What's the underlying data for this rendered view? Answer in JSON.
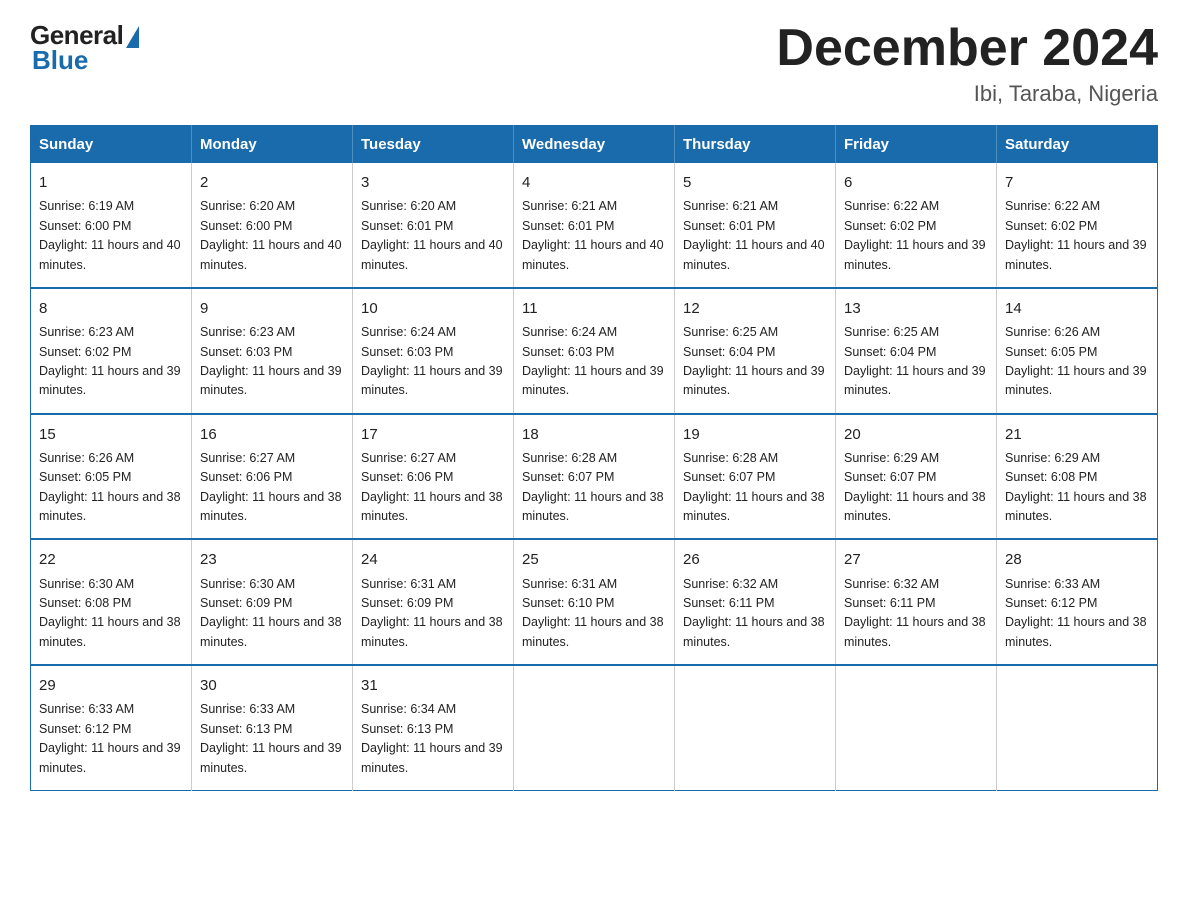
{
  "header": {
    "logo_general": "General",
    "logo_blue": "Blue",
    "title": "December 2024",
    "subtitle": "Ibi, Taraba, Nigeria"
  },
  "weekdays": [
    "Sunday",
    "Monday",
    "Tuesday",
    "Wednesday",
    "Thursday",
    "Friday",
    "Saturday"
  ],
  "weeks": [
    [
      {
        "day": "1",
        "sunrise": "6:19 AM",
        "sunset": "6:00 PM",
        "daylight": "11 hours and 40 minutes."
      },
      {
        "day": "2",
        "sunrise": "6:20 AM",
        "sunset": "6:00 PM",
        "daylight": "11 hours and 40 minutes."
      },
      {
        "day": "3",
        "sunrise": "6:20 AM",
        "sunset": "6:01 PM",
        "daylight": "11 hours and 40 minutes."
      },
      {
        "day": "4",
        "sunrise": "6:21 AM",
        "sunset": "6:01 PM",
        "daylight": "11 hours and 40 minutes."
      },
      {
        "day": "5",
        "sunrise": "6:21 AM",
        "sunset": "6:01 PM",
        "daylight": "11 hours and 40 minutes."
      },
      {
        "day": "6",
        "sunrise": "6:22 AM",
        "sunset": "6:02 PM",
        "daylight": "11 hours and 39 minutes."
      },
      {
        "day": "7",
        "sunrise": "6:22 AM",
        "sunset": "6:02 PM",
        "daylight": "11 hours and 39 minutes."
      }
    ],
    [
      {
        "day": "8",
        "sunrise": "6:23 AM",
        "sunset": "6:02 PM",
        "daylight": "11 hours and 39 minutes."
      },
      {
        "day": "9",
        "sunrise": "6:23 AM",
        "sunset": "6:03 PM",
        "daylight": "11 hours and 39 minutes."
      },
      {
        "day": "10",
        "sunrise": "6:24 AM",
        "sunset": "6:03 PM",
        "daylight": "11 hours and 39 minutes."
      },
      {
        "day": "11",
        "sunrise": "6:24 AM",
        "sunset": "6:03 PM",
        "daylight": "11 hours and 39 minutes."
      },
      {
        "day": "12",
        "sunrise": "6:25 AM",
        "sunset": "6:04 PM",
        "daylight": "11 hours and 39 minutes."
      },
      {
        "day": "13",
        "sunrise": "6:25 AM",
        "sunset": "6:04 PM",
        "daylight": "11 hours and 39 minutes."
      },
      {
        "day": "14",
        "sunrise": "6:26 AM",
        "sunset": "6:05 PM",
        "daylight": "11 hours and 39 minutes."
      }
    ],
    [
      {
        "day": "15",
        "sunrise": "6:26 AM",
        "sunset": "6:05 PM",
        "daylight": "11 hours and 38 minutes."
      },
      {
        "day": "16",
        "sunrise": "6:27 AM",
        "sunset": "6:06 PM",
        "daylight": "11 hours and 38 minutes."
      },
      {
        "day": "17",
        "sunrise": "6:27 AM",
        "sunset": "6:06 PM",
        "daylight": "11 hours and 38 minutes."
      },
      {
        "day": "18",
        "sunrise": "6:28 AM",
        "sunset": "6:07 PM",
        "daylight": "11 hours and 38 minutes."
      },
      {
        "day": "19",
        "sunrise": "6:28 AM",
        "sunset": "6:07 PM",
        "daylight": "11 hours and 38 minutes."
      },
      {
        "day": "20",
        "sunrise": "6:29 AM",
        "sunset": "6:07 PM",
        "daylight": "11 hours and 38 minutes."
      },
      {
        "day": "21",
        "sunrise": "6:29 AM",
        "sunset": "6:08 PM",
        "daylight": "11 hours and 38 minutes."
      }
    ],
    [
      {
        "day": "22",
        "sunrise": "6:30 AM",
        "sunset": "6:08 PM",
        "daylight": "11 hours and 38 minutes."
      },
      {
        "day": "23",
        "sunrise": "6:30 AM",
        "sunset": "6:09 PM",
        "daylight": "11 hours and 38 minutes."
      },
      {
        "day": "24",
        "sunrise": "6:31 AM",
        "sunset": "6:09 PM",
        "daylight": "11 hours and 38 minutes."
      },
      {
        "day": "25",
        "sunrise": "6:31 AM",
        "sunset": "6:10 PM",
        "daylight": "11 hours and 38 minutes."
      },
      {
        "day": "26",
        "sunrise": "6:32 AM",
        "sunset": "6:11 PM",
        "daylight": "11 hours and 38 minutes."
      },
      {
        "day": "27",
        "sunrise": "6:32 AM",
        "sunset": "6:11 PM",
        "daylight": "11 hours and 38 minutes."
      },
      {
        "day": "28",
        "sunrise": "6:33 AM",
        "sunset": "6:12 PM",
        "daylight": "11 hours and 38 minutes."
      }
    ],
    [
      {
        "day": "29",
        "sunrise": "6:33 AM",
        "sunset": "6:12 PM",
        "daylight": "11 hours and 39 minutes."
      },
      {
        "day": "30",
        "sunrise": "6:33 AM",
        "sunset": "6:13 PM",
        "daylight": "11 hours and 39 minutes."
      },
      {
        "day": "31",
        "sunrise": "6:34 AM",
        "sunset": "6:13 PM",
        "daylight": "11 hours and 39 minutes."
      },
      null,
      null,
      null,
      null
    ]
  ],
  "cell_labels": {
    "sunrise": "Sunrise:",
    "sunset": "Sunset:",
    "daylight": "Daylight:"
  }
}
